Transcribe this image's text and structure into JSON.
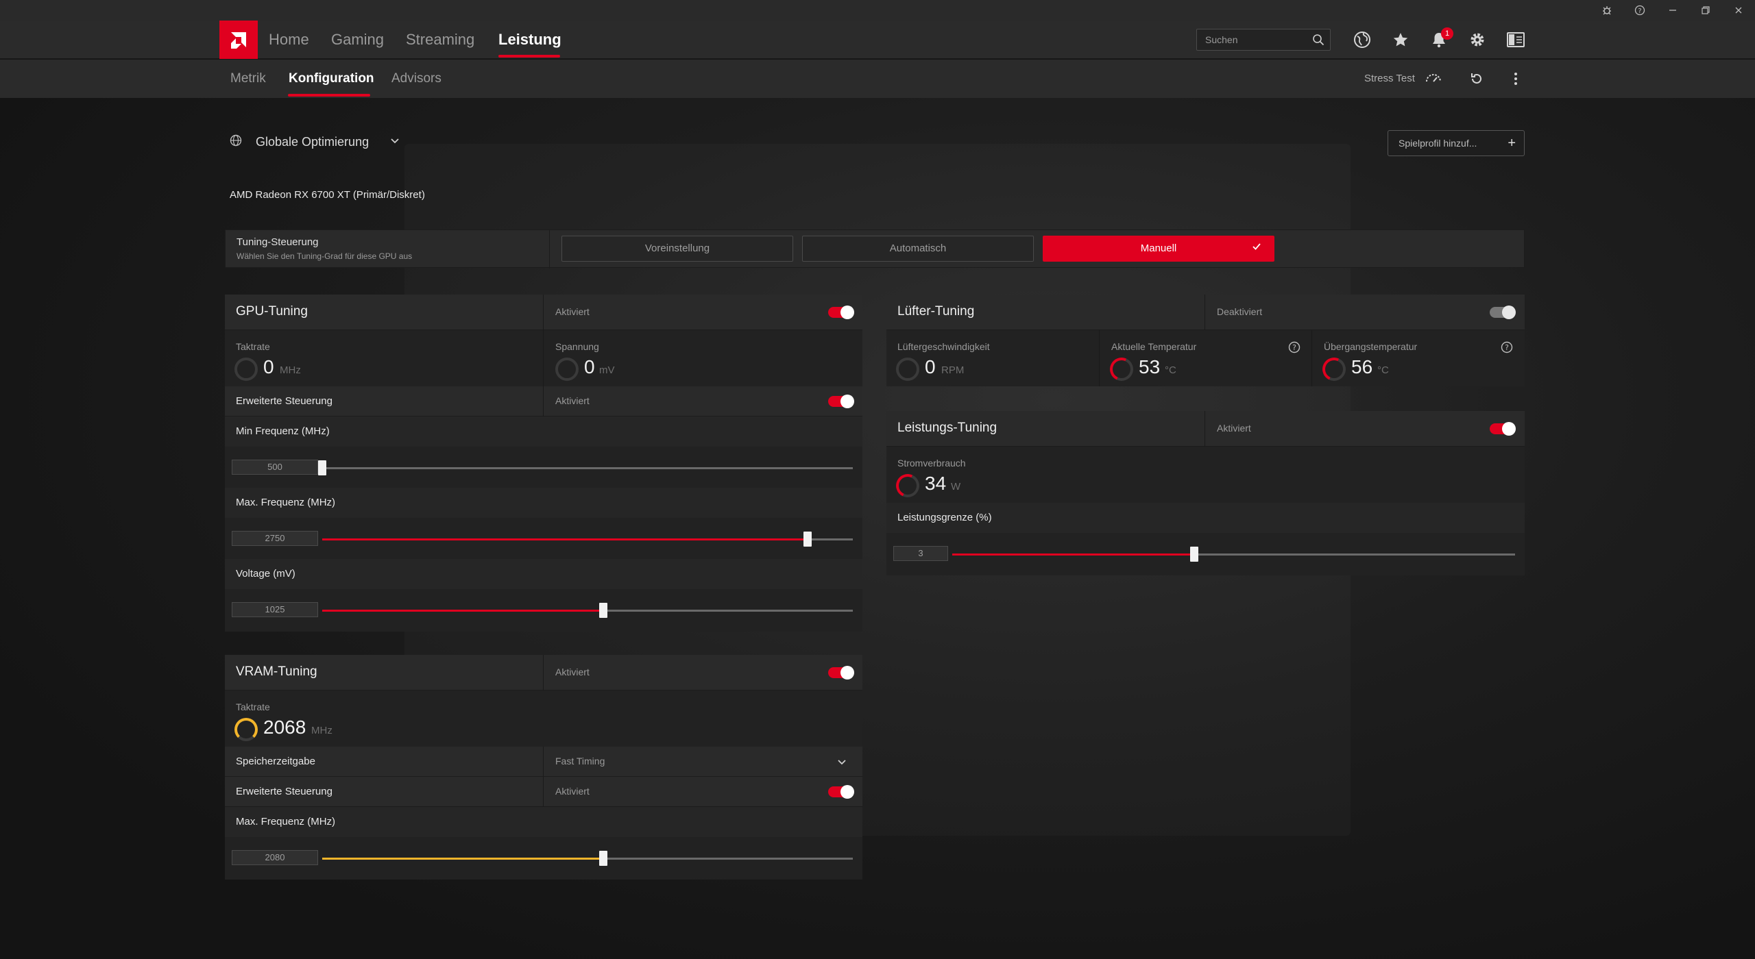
{
  "colors": {
    "accent": "#e0001f",
    "vram_accent": "#f3b52b",
    "background": "#151515"
  },
  "window": {
    "icons": [
      "bug-icon",
      "help-icon",
      "minimize-icon",
      "restore-icon",
      "close-icon"
    ]
  },
  "nav": {
    "tabs": [
      {
        "label": "Home"
      },
      {
        "label": "Gaming"
      },
      {
        "label": "Streaming"
      },
      {
        "label": "Leistung"
      }
    ],
    "active_tab": "Leistung",
    "search": {
      "placeholder": "Suchen"
    },
    "notification_count": "1"
  },
  "subnav": {
    "tabs": [
      {
        "label": "Metrik"
      },
      {
        "label": "Konfiguration"
      },
      {
        "label": "Advisors"
      }
    ],
    "active_tab": "Konfiguration",
    "stress_test": "Stress Test"
  },
  "profile": {
    "selected": "Globale Optimierung",
    "add_button": "Spielprofil hinzuf..."
  },
  "gpu_name": "AMD Radeon RX 6700 XT (Primär/Diskret)",
  "tuning_control": {
    "title": "Tuning-Steuerung",
    "subtitle": "Wählen Sie den Tuning-Grad für diese GPU aus",
    "options": [
      "Voreinstellung",
      "Automatisch",
      "Manuell"
    ],
    "selected": "Manuell"
  },
  "gpu_tuning": {
    "title": "GPU-Tuning",
    "state": "Aktiviert",
    "enabled": true,
    "clock": {
      "label": "Taktrate",
      "value": "0",
      "unit": "MHz"
    },
    "voltage": {
      "label": "Spannung",
      "value": "0",
      "unit": "mV"
    },
    "advanced": {
      "label": "Erweiterte Steuerung",
      "state": "Aktiviert",
      "enabled": true
    },
    "min_freq": {
      "label": "Min Frequenz (MHz)",
      "value": "500",
      "fraction": 0.0
    },
    "max_freq": {
      "label": "Max. Frequenz (MHz)",
      "value": "2750",
      "fraction": 0.915
    },
    "voltage_slider": {
      "label": "Voltage (mV)",
      "value": "1025",
      "fraction": 0.53
    }
  },
  "vram_tuning": {
    "title": "VRAM-Tuning",
    "state": "Aktiviert",
    "enabled": true,
    "clock": {
      "label": "Taktrate",
      "value": "2068",
      "unit": "MHz"
    },
    "memory_timing": {
      "label": "Speicherzeitgabe",
      "value": "Fast Timing"
    },
    "advanced": {
      "label": "Erweiterte Steuerung",
      "state": "Aktiviert",
      "enabled": true
    },
    "max_freq": {
      "label": "Max. Frequenz (MHz)",
      "value": "2080",
      "fraction": 0.53
    }
  },
  "fan_tuning": {
    "title": "Lüfter-Tuning",
    "state": "Deaktiviert",
    "enabled": false,
    "fan_speed": {
      "label": "Lüftergeschwindigkeit",
      "value": "0",
      "unit": "RPM"
    },
    "current_temp": {
      "label": "Aktuelle Temperatur",
      "value": "53",
      "unit": "°C"
    },
    "junction_temp": {
      "label": "Übergangstemperatur",
      "value": "56",
      "unit": "°C"
    }
  },
  "power_tuning": {
    "title": "Leistungs-Tuning",
    "state": "Aktiviert",
    "enabled": true,
    "power_draw": {
      "label": "Stromverbrauch",
      "value": "34",
      "unit": "W"
    },
    "power_limit": {
      "label": "Leistungsgrenze (%)",
      "value": "3",
      "fraction": 0.43
    }
  }
}
